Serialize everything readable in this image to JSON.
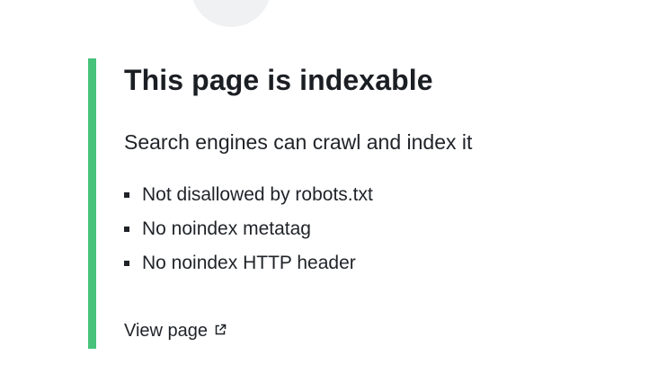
{
  "status": {
    "title": "This page is indexable",
    "subtitle": "Search engines can crawl and index it",
    "accent_color": "#47c27a",
    "checks": [
      "Not disallowed by robots.txt",
      "No noindex metatag",
      "No noindex HTTP header"
    ]
  },
  "actions": {
    "view_page_label": "View page",
    "view_page_icon": "external-link-icon"
  }
}
